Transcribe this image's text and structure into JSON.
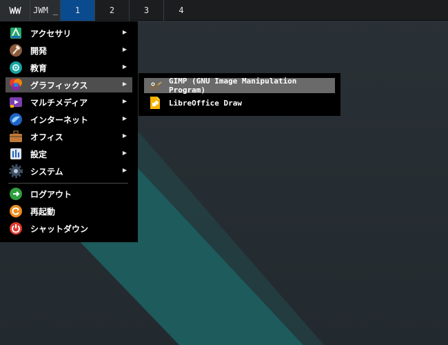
{
  "taskbar": {
    "jwm_label": "JWM",
    "minimize_label": "_",
    "workspaces": [
      "1",
      "2",
      "3",
      "4"
    ],
    "active_workspace": "1"
  },
  "menu": {
    "items": [
      {
        "label": "アクセサリ",
        "icon": "accessories-icon",
        "has_submenu": true
      },
      {
        "label": "開発",
        "icon": "development-hammer-icon",
        "has_submenu": true
      },
      {
        "label": "教育",
        "icon": "education-icon",
        "has_submenu": true
      },
      {
        "label": "グラフィックス",
        "icon": "graphics-icon",
        "has_submenu": true,
        "selected": true
      },
      {
        "label": "マルチメディア",
        "icon": "multimedia-icon",
        "has_submenu": true
      },
      {
        "label": "インターネット",
        "icon": "internet-globe-icon",
        "has_submenu": true
      },
      {
        "label": "オフィス",
        "icon": "office-briefcase-icon",
        "has_submenu": true
      },
      {
        "label": "設定",
        "icon": "settings-panel-icon",
        "has_submenu": true
      },
      {
        "label": "システム",
        "icon": "system-gear-icon",
        "has_submenu": true
      }
    ],
    "actions": [
      {
        "label": "ログアウト",
        "icon": "logout-icon"
      },
      {
        "label": "再起動",
        "icon": "restart-icon"
      },
      {
        "label": "シャットダウン",
        "icon": "shutdown-icon"
      }
    ],
    "submenu_arrow": "▶"
  },
  "submenu": {
    "items": [
      {
        "label": "GIMP (GNU Image Manipulation Program)",
        "icon": "gimp-icon",
        "selected": true
      },
      {
        "label": "LibreOffice Draw",
        "icon": "libreoffice-draw-icon"
      }
    ]
  },
  "colors": {
    "taskbar_bg": "#1b1d1f",
    "active_workspace": "#0a4a8f",
    "menu_bg": "#000000",
    "selected_bg": "#4e4e4e",
    "wallpaper_accent": "#1d5e5e"
  }
}
